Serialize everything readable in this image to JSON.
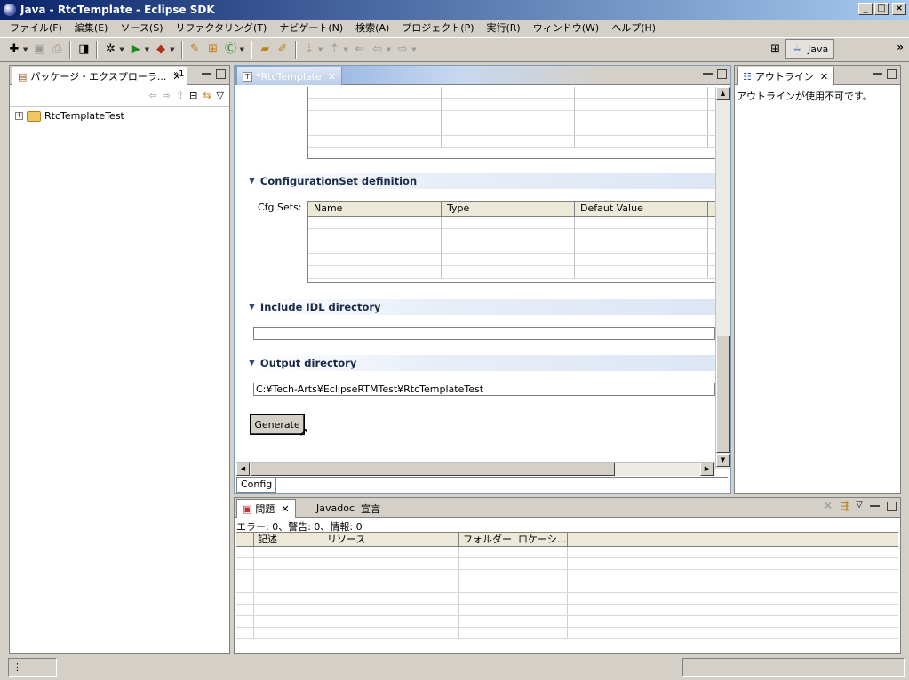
{
  "window": {
    "title": "Java - RtcTemplate - Eclipse SDK"
  },
  "menu": [
    "ファイル(F)",
    "編集(E)",
    "ソース(S)",
    "リファクタリング(T)",
    "ナビゲート(N)",
    "検索(A)",
    "プロジェクト(P)",
    "実行(R)",
    "ウィンドウ(W)",
    "ヘルプ(H)"
  ],
  "perspective": {
    "label": "Java"
  },
  "package_explorer": {
    "title": "パッケージ・エクスプローラ...",
    "overflow_count": "»1",
    "tree": [
      {
        "label": "RtcTemplateTest"
      }
    ]
  },
  "editor": {
    "tab_title": "*RtcTemplate",
    "configset": {
      "section_title": "ConfigurationSet definition",
      "label": "Cfg Sets:",
      "columns": [
        "Name",
        "Type",
        "Defaut Value"
      ]
    },
    "include_idl": {
      "section_title": "Include IDL directory",
      "value": ""
    },
    "output_dir": {
      "section_title": "Output directory",
      "value": "C:¥Tech-Arts¥EclipseRTMTest¥RtcTemplateTest"
    },
    "generate_label": "Generate",
    "page_tab": "Config"
  },
  "outline": {
    "title": "アウトライン",
    "message": "アウトラインが使用不可です。"
  },
  "problems": {
    "tabs": [
      "問題",
      "Javadoc",
      "宣言"
    ],
    "summary": "エラー: 0、警告: 0、情報: 0",
    "columns": [
      "",
      "記述",
      "リソース",
      "フォルダー",
      "ロケーシ..."
    ]
  },
  "status": {
    "indicator": "⋮"
  }
}
